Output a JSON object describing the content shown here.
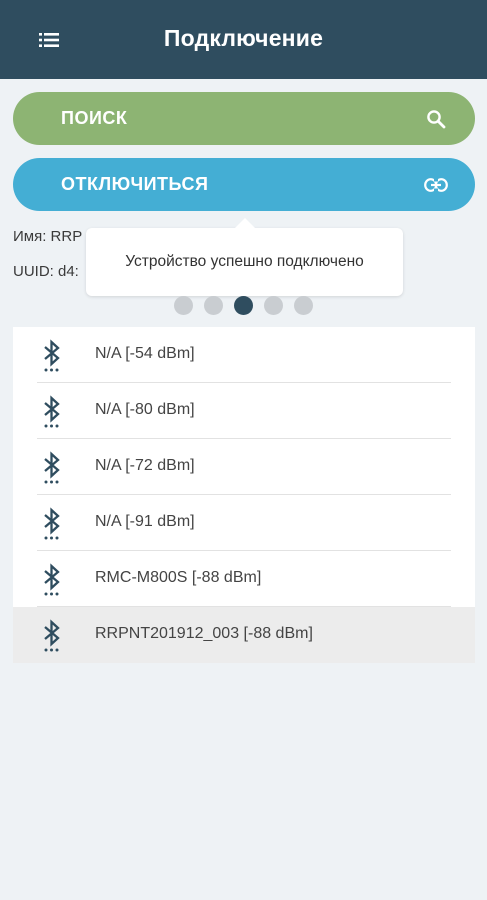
{
  "header": {
    "title": "Подключение",
    "menu_icon": "list-menu-icon"
  },
  "buttons": {
    "search": {
      "label": "ПОИСК",
      "icon": "search-icon"
    },
    "disconnect": {
      "label": "ОТКЛЮЧИТЬСЯ",
      "icon": "link-icon"
    }
  },
  "device_info": {
    "name_text": "Имя: RRP",
    "uuid_text": "UUID: d4:"
  },
  "toast": {
    "message": "Устройство успешно подключено"
  },
  "pager": {
    "count": 5,
    "active_index": 2
  },
  "devices": [
    {
      "label": "N/A [-54 dBm]",
      "icon": "bluetooth-searching-icon"
    },
    {
      "label": "N/A [-80 dBm]",
      "icon": "bluetooth-searching-icon"
    },
    {
      "label": "N/A [-72 dBm]",
      "icon": "bluetooth-searching-icon"
    },
    {
      "label": "N/A [-91 dBm]",
      "icon": "bluetooth-searching-icon"
    },
    {
      "label": "RMC-M800S [-88 dBm]",
      "icon": "bluetooth-searching-icon"
    },
    {
      "label": "RRPNT201912_003 [-88 dBm]",
      "icon": "bluetooth-searching-icon",
      "selected": true
    }
  ],
  "colors": {
    "header": "#2f4d5f",
    "search_button": "#8db473",
    "disconnect_button": "#44aed4",
    "bluetooth_icon": "#2f4d5f"
  }
}
